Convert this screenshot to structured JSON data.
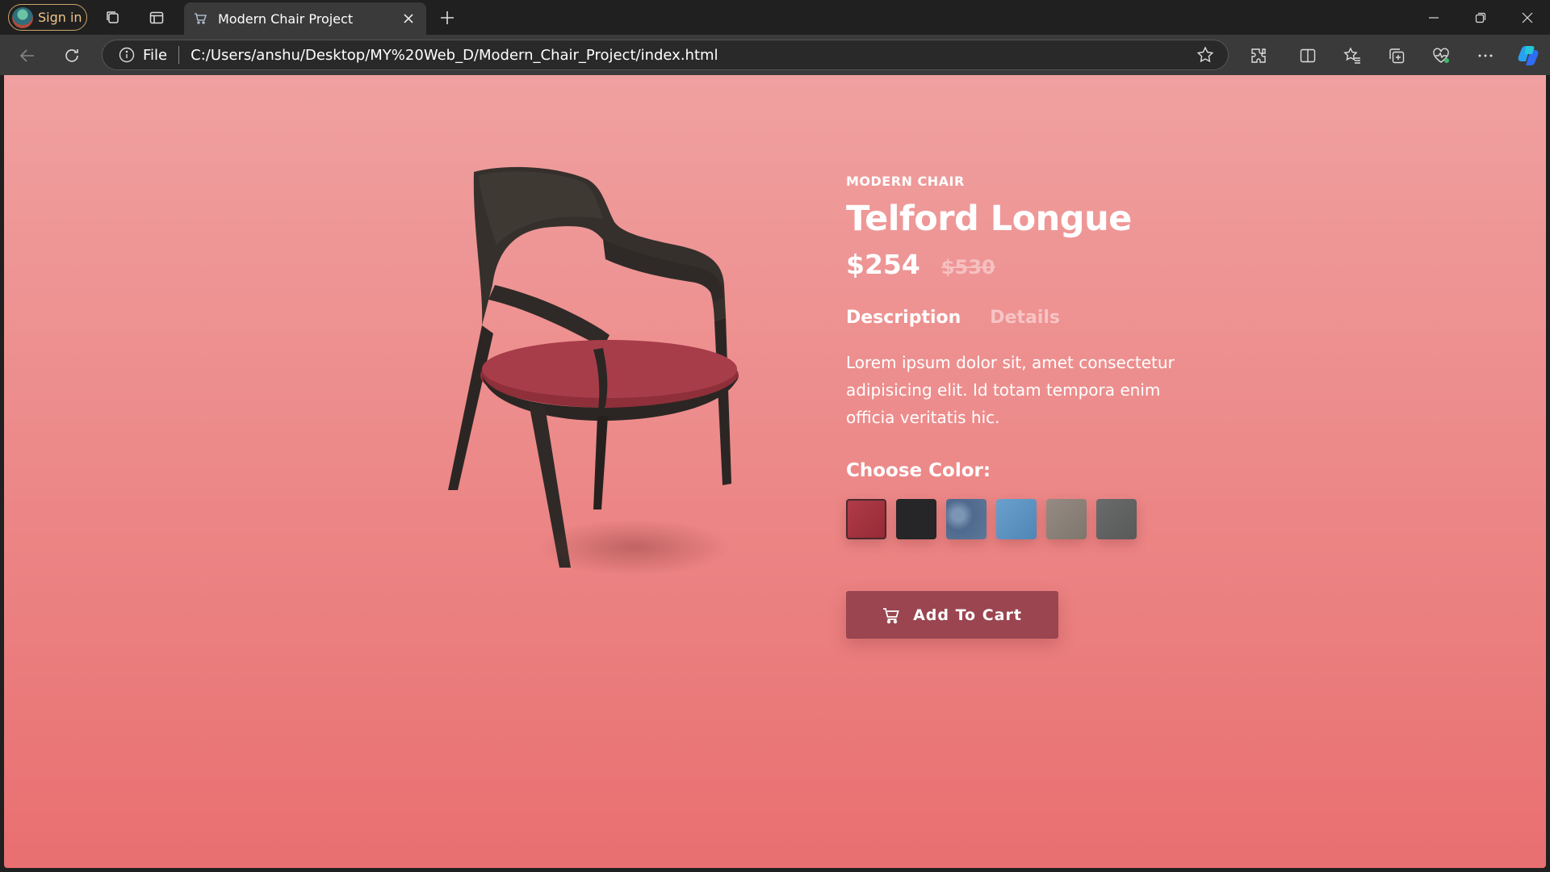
{
  "browser": {
    "signin_label": "Sign in",
    "tab_title": "Modern Chair Project",
    "address": {
      "scheme_label": "File",
      "url": "C:/Users/anshu/Desktop/MY%20Web_D/Modern_Chair_Project/index.html"
    }
  },
  "product": {
    "category": "MODERN CHAIR",
    "name": "Telford Longue",
    "price": "$254",
    "old_price": "$530",
    "tabs": [
      "Description",
      "Details"
    ],
    "active_tab": "Description",
    "description": "Lorem ipsum dolor sit, amet consectetur adipisicing elit. Id totam tempora enim officia veritatis hic.",
    "color_label": "Choose Color:",
    "colors": [
      {
        "name": "red-fabric",
        "hex": "#a3343f",
        "selected": true
      },
      {
        "name": "black",
        "hex": "#262527",
        "selected": false
      },
      {
        "name": "blue-denim",
        "hex": "#5a7598",
        "selected": false
      },
      {
        "name": "light-blue",
        "hex": "#5e93c0",
        "selected": false
      },
      {
        "name": "taupe",
        "hex": "#8c827a",
        "selected": false
      },
      {
        "name": "grey",
        "hex": "#626363",
        "selected": false
      }
    ],
    "cart_label": "Add To Cart"
  },
  "colors": {
    "page_top": "#f0a0a0",
    "page_bottom": "#e96f70",
    "cart_button": "#9a4550",
    "chair_wood": "#2f2a27",
    "chair_seat": "#a83d4a"
  }
}
